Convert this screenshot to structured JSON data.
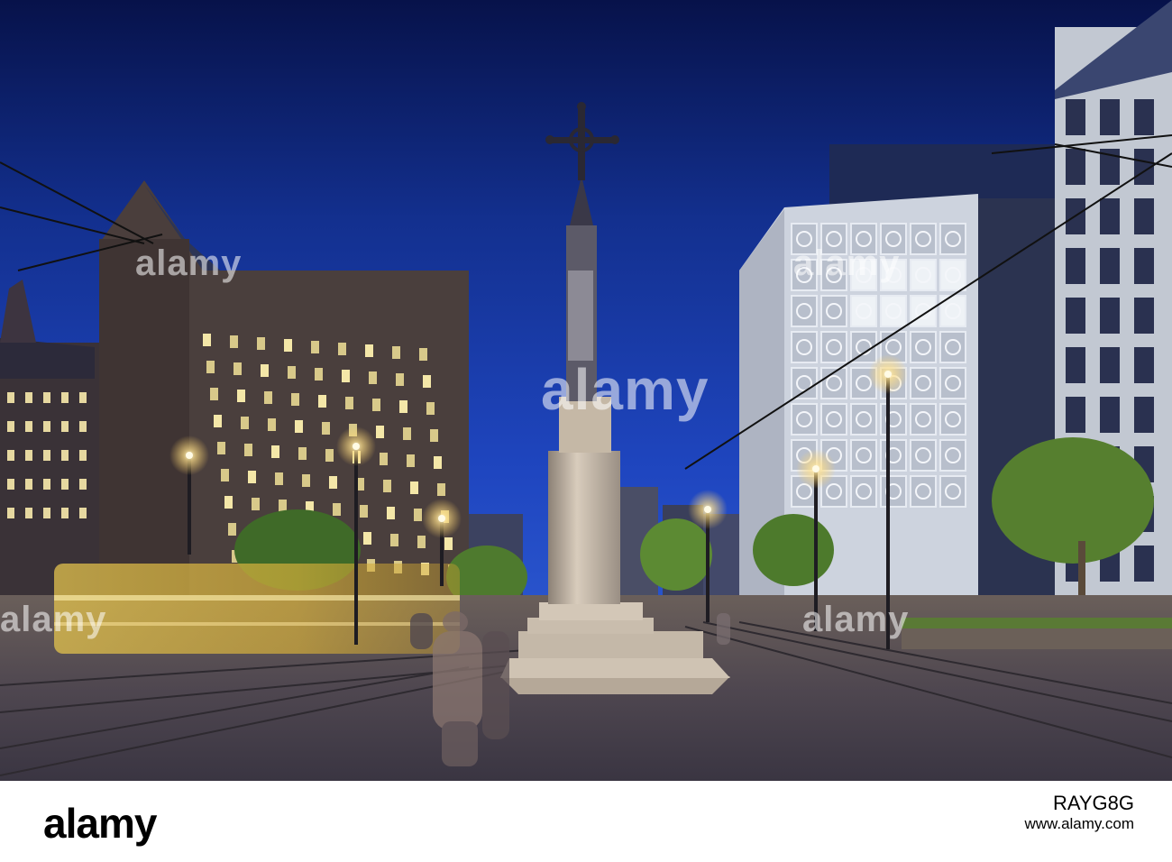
{
  "watermark": {
    "text": "alamy",
    "image_id": "RAYG8G",
    "site": "www.alamy.com"
  },
  "colors": {
    "sky_top": "#06134d",
    "sky_mid": "#1a3fb0",
    "building_left": "#453a38",
    "building_right": "#c9d0dc",
    "street_light": "#ffe9a8",
    "tram_blur": "#d9b548",
    "pavement": "#4a4550"
  },
  "scene": {
    "subject": "stone memorial cross",
    "icons": [
      "street-lamp",
      "tram",
      "tree"
    ]
  }
}
